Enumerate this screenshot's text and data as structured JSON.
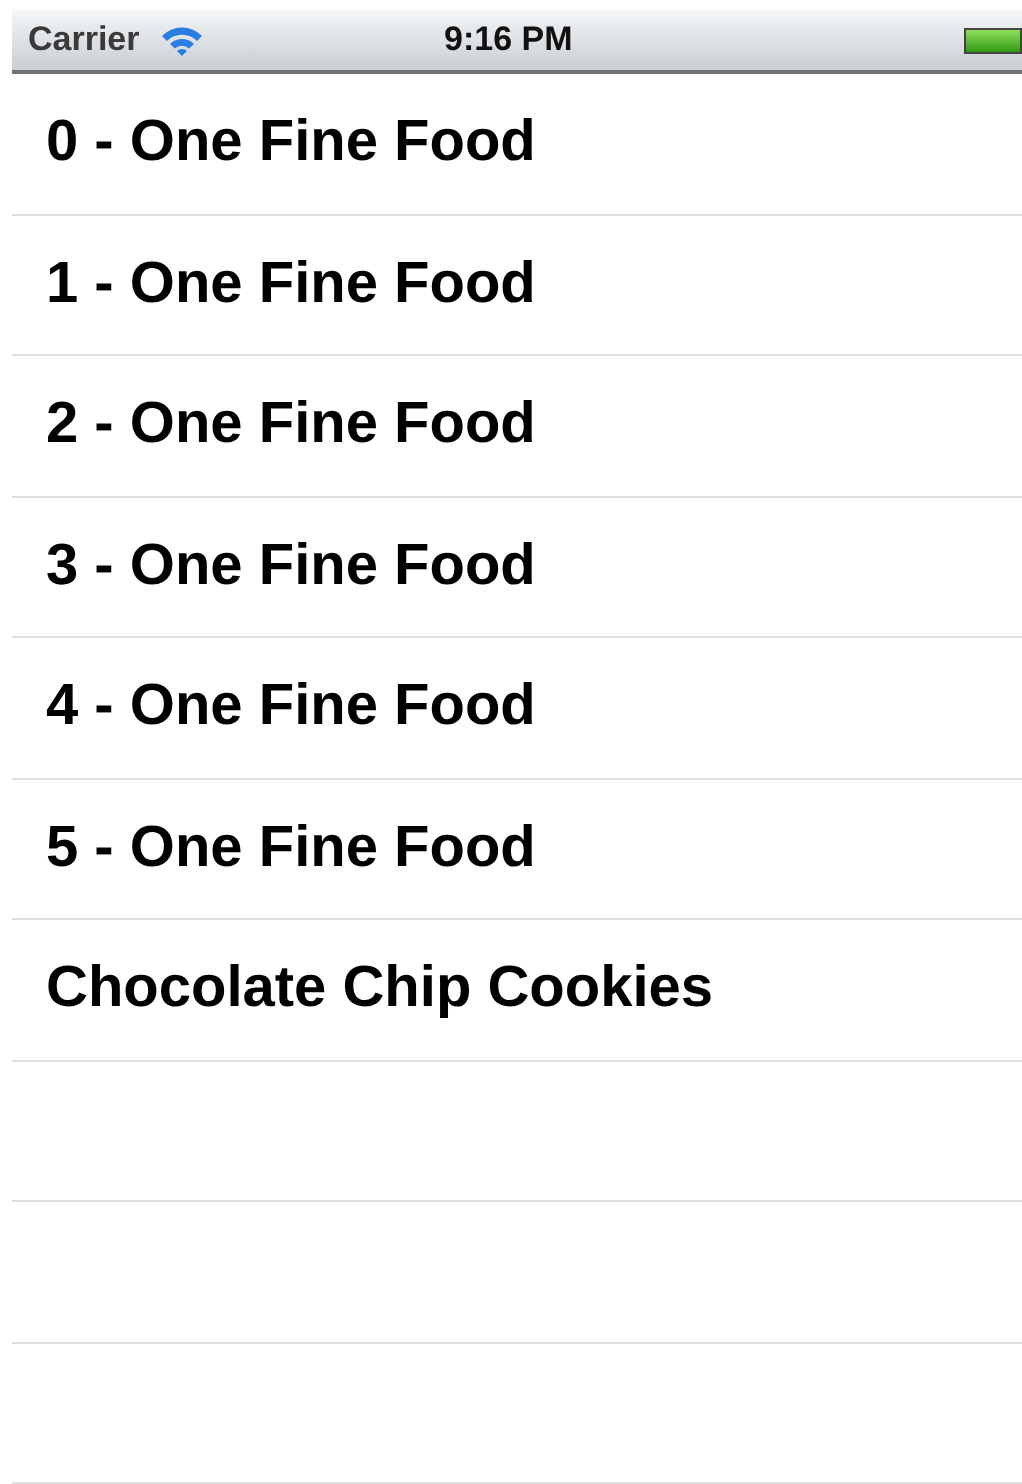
{
  "status_bar": {
    "carrier": "Carrier",
    "time": "9:16 PM"
  },
  "list": {
    "items": [
      {
        "label": "0 - One Fine Food"
      },
      {
        "label": "1 - One Fine Food"
      },
      {
        "label": "2 - One Fine Food"
      },
      {
        "label": "3 - One Fine Food"
      },
      {
        "label": "4 - One Fine Food"
      },
      {
        "label": "5 - One Fine Food"
      },
      {
        "label": "Chocolate Chip Cookies"
      }
    ]
  }
}
